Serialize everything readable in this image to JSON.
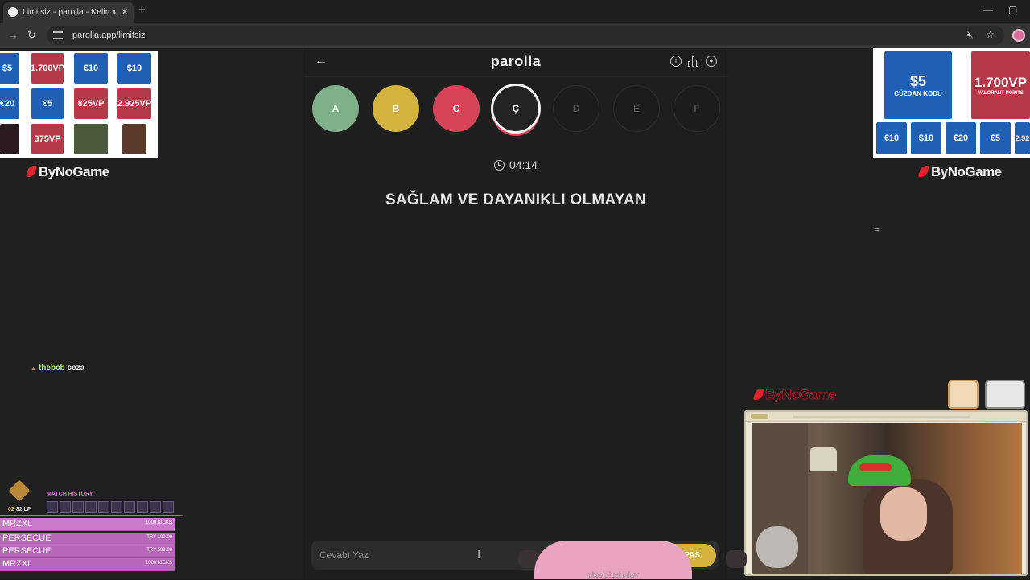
{
  "browser": {
    "tab_title": "Limitsiz - parolla - Kelime o",
    "new_tab": "+",
    "close_tab": "✕",
    "url": "parolla.app/limitsiz",
    "controls": {
      "minimize": "—",
      "maximize": "▢"
    }
  },
  "app": {
    "brand": "parolla",
    "back": "←",
    "letters": [
      {
        "label": "A",
        "state": "correct"
      },
      {
        "label": "B",
        "state": "passed"
      },
      {
        "label": "C",
        "state": "wrong"
      },
      {
        "label": "Ç",
        "state": "active"
      },
      {
        "label": "D",
        "state": "pending"
      },
      {
        "label": "E",
        "state": "pending"
      },
      {
        "label": "F",
        "state": "pending"
      }
    ],
    "timer": "04:14",
    "question": "SAĞLAM VE DAYANIKLI OLMAYAN",
    "answer_placeholder": "Cevabı Yaz",
    "pass_label": "PAS",
    "pass_arrow": "›",
    "colors": {
      "correct": "#7eb08a",
      "passed": "#d3b33d",
      "wrong": "#d74457"
    }
  },
  "ads": {
    "left_label": "ByNoGame",
    "right_label": "ByNoGame",
    "left_cards": [
      "$5",
      "1.700VP",
      "€10",
      "$10",
      "€20",
      "€5",
      "825VP",
      "2.925VP",
      "",
      "375VP",
      "",
      ""
    ],
    "right_cards": [
      "$5",
      "1.700VP",
      "€10",
      "$10",
      "€20",
      "€5",
      "2.92"
    ],
    "right_main": "CÜZDAN KODU",
    "right_sub": "VALORANT POINTS"
  },
  "stream": {
    "chat_user": "thebcb",
    "chat_message": "ceza",
    "overlay_logo": "ByNoGame",
    "rank_lp_prefix": "02",
    "rank_lp": "82 LP",
    "match_history_title": "MATCH HISTORY",
    "history": [
      {
        "name": "MRZXL",
        "amount": "1000 KICKS"
      },
      {
        "name": "PERSECUE",
        "amount": "TRY 100.00"
      },
      {
        "name": "PERSECUE",
        "amount": "TRY 509.00"
      },
      {
        "name": "MRZXL",
        "amount": "1000 KICKS"
      }
    ],
    "watermark": "pixelplush.dev"
  }
}
